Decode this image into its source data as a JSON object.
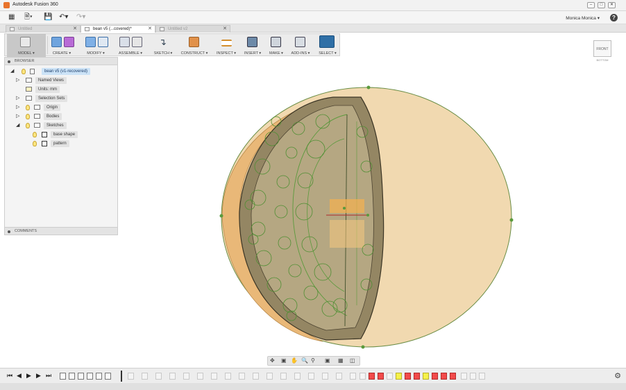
{
  "app": {
    "title": "Autodesk Fusion 360",
    "window_buttons": [
      "–",
      "□",
      "✕"
    ]
  },
  "quick_access": {
    "grid_icon": "grid-icon",
    "file_icon": "file-icon",
    "save_icon": "save-icon",
    "undo_icon": "undo-icon",
    "redo_icon": "redo-icon",
    "user": "Monica Monica ▾",
    "help": "?"
  },
  "tabs": [
    {
      "label": "Untitled",
      "close": "✕"
    },
    {
      "label": "bean v5 (...covered)*",
      "close": "✕"
    },
    {
      "label": "Untitled v2",
      "close": "✕"
    }
  ],
  "ribbon": {
    "workspace": "MODEL ▾",
    "groups": [
      {
        "label": "CREATE ▾"
      },
      {
        "label": "MODIFY ▾"
      },
      {
        "label": "ASSEMBLE ▾"
      },
      {
        "label": "SKETCH ▾"
      },
      {
        "label": "CONSTRUCT ▾"
      },
      {
        "label": "INSPECT ▾"
      },
      {
        "label": "INSERT ▾"
      },
      {
        "label": "MAKE ▾"
      },
      {
        "label": "ADD-INS ▾"
      },
      {
        "label": "SELECT ▾"
      }
    ]
  },
  "browser": {
    "header": "BROWSER",
    "root": "bean v5 (v1-recovered)",
    "items": [
      {
        "label": "Named Views"
      },
      {
        "label": "Units: mm"
      },
      {
        "label": "Selection Sets"
      },
      {
        "label": "Origin"
      },
      {
        "label": "Bodies"
      },
      {
        "label": "Sketches"
      },
      {
        "label": "base shape"
      },
      {
        "label": "pattern"
      }
    ]
  },
  "comments": {
    "header": "COMMENTS"
  },
  "viewcube": {
    "face": "FRONT",
    "label": "BOTTOM"
  },
  "colors": {
    "sketch_green": "#5a9a3c",
    "body_tan": "#8a7c5a",
    "disc_fill": "#f3dcb4",
    "highlight": "#f24b4b"
  }
}
